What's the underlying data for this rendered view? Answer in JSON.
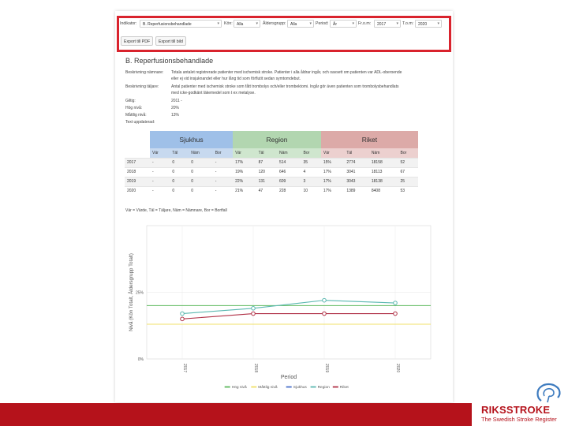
{
  "filters": {
    "indikator_label": "Indikator:",
    "indikator_value": "B. Reperfusionsbehandlade",
    "kon_label": "Kön:",
    "kon_value": "Alla",
    "aldersgrupp_label": "Åldersgrupp:",
    "aldersgrupp_value": "Alla",
    "period_label": "Period:",
    "period_value": "År",
    "from_label": "Fr.o.m:",
    "from_value": "2017",
    "tom_label": "T.o.m:",
    "tom_value": "2020"
  },
  "buttons": {
    "pdf": "Export till PDF",
    "image": "Export till bild"
  },
  "indicator": {
    "title": "B. Reperfusionsbehandlade",
    "rows": [
      {
        "key": "Beskrivning nämnare:",
        "value": "Totala antalet registrerade patienter med ischemisk stroke. Patienter i alla åldrar ingår, och oavsett om patienten var ADL-oberoende eller ej vid insjuknandet eller hur lång tid som förflutit sedan symtomdebut."
      },
      {
        "key": "Beskrivning täljare:",
        "value": "Antal patienter med ischemisk stroke som fått trombolys och/eller trombektomi. Ingår gör även patienten som trombolysbehandlats med icke-godkänt läkemedel som t ex metalyse."
      },
      {
        "key": "Giltig:",
        "value": "2011 -"
      },
      {
        "key": "Hög nivå:",
        "value": "20%"
      },
      {
        "key": "Måttlig nivå:",
        "value": "13%"
      },
      {
        "key": "Text uppdaterad:",
        "value": ""
      }
    ]
  },
  "table": {
    "groups": [
      "Sjukhus",
      "Region",
      "Riket"
    ],
    "subheaders": [
      "Vär",
      "Täl",
      "Näm",
      "Bor"
    ],
    "rows": [
      {
        "year": "2017",
        "cells": [
          "-",
          "0",
          "0",
          "-",
          "17%",
          "87",
          "514",
          "35",
          "15%",
          "2774",
          "18158",
          "52"
        ]
      },
      {
        "year": "2018",
        "cells": [
          "-",
          "0",
          "0",
          "-",
          "19%",
          "120",
          "646",
          "4",
          "17%",
          "3041",
          "18113",
          "67"
        ]
      },
      {
        "year": "2019",
        "cells": [
          "-",
          "0",
          "0",
          "-",
          "22%",
          "131",
          "609",
          "3",
          "17%",
          "3043",
          "18138",
          "25"
        ]
      },
      {
        "year": "2020",
        "cells": [
          "-",
          "0",
          "0",
          "-",
          "21%",
          "47",
          "228",
          "10",
          "17%",
          "1389",
          "8408",
          "53"
        ]
      }
    ],
    "note": "Vär = Värde, Täl = Täljare, Näm = Nämnare, Bor = Bortfall"
  },
  "chart_data": {
    "type": "line",
    "x": [
      "2017",
      "2018",
      "2019",
      "2020"
    ],
    "xlabel": "Period",
    "ylabel": "Nivå (Kön Totalt, Åldersgrupp Totalt)",
    "yticks": [
      "0%",
      "25%"
    ],
    "ylim": [
      0,
      0.5
    ],
    "legend_position": "bottom",
    "series": [
      {
        "name": "Hög nivå",
        "color": "#5cb85c",
        "values": [
          0.2,
          0.2,
          0.2,
          0.2
        ],
        "markers": false
      },
      {
        "name": "Måttlig nivå",
        "color": "#f0e068",
        "values": [
          0.13,
          0.13,
          0.13,
          0.13
        ],
        "markers": false
      },
      {
        "name": "Sjukhus",
        "color": "#4a6fc9",
        "values": [
          null,
          null,
          null,
          null
        ],
        "markers": false
      },
      {
        "name": "Region",
        "color": "#5bb8b0",
        "values": [
          0.17,
          0.19,
          0.22,
          0.21
        ],
        "markers": true
      },
      {
        "name": "Riket",
        "color": "#b03046",
        "values": [
          0.15,
          0.17,
          0.17,
          0.17
        ],
        "markers": true
      }
    ]
  },
  "brand": {
    "name": "RIKSSTROKE",
    "tagline": "The Swedish Stroke Register",
    "color": "#b5121b"
  }
}
